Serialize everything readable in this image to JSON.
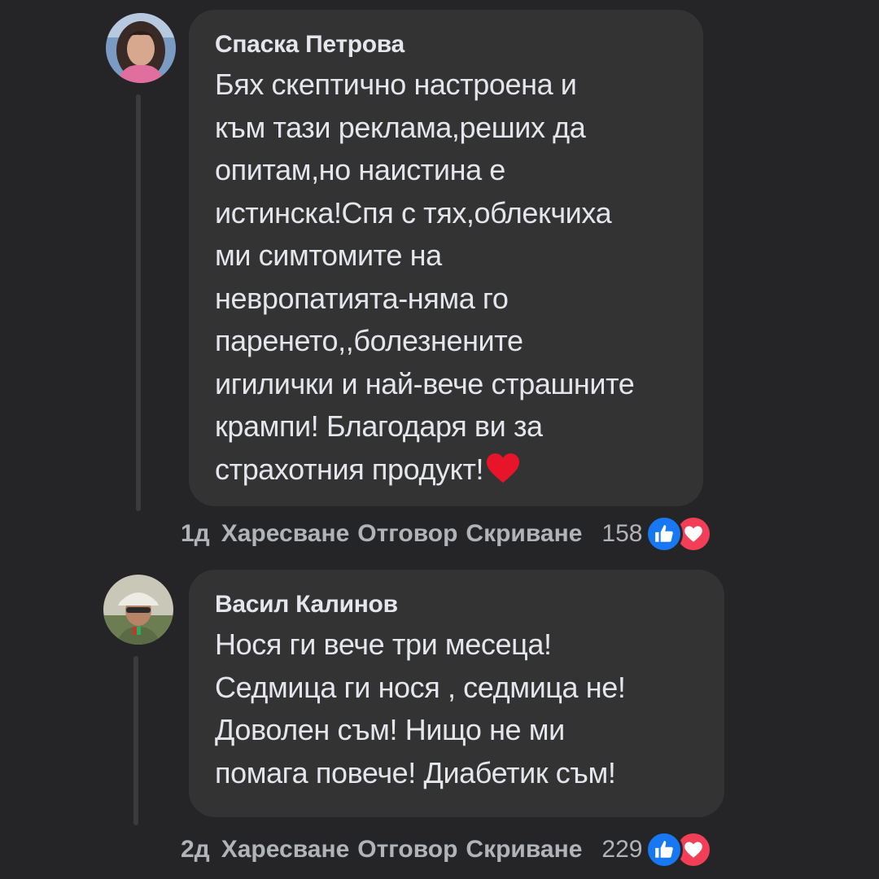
{
  "comments": [
    {
      "author": "Спаска Петрова",
      "text": "Бях скептично настроена и\nкъм тази реклама,реших да\nопитам,но наистина е\nистинска!Спя с тях,облекчиха\nми симтомите на\nневропатията-няма го\nпаренето,,болезнените\nигилички и най-вече страшните\nкрампи! Благодаря ви за\nстрахотния продукт!",
      "trailing_emoji": "red-heart",
      "time": "1д",
      "like_label": "Харесване",
      "reply_label": "Отговор",
      "hide_label": "Скриване",
      "reaction_count": "158",
      "reactions": [
        "like",
        "love"
      ]
    },
    {
      "author": "Васил Калинов",
      "text": "Нося ги вече три месеца!\nСедмица ги нося , седмица не!\nДоволен съм! Нищо не ми\nпомага повече! Диабетик съм!",
      "time": "2д",
      "like_label": "Харесване",
      "reply_label": "Отговор",
      "hide_label": "Скриване",
      "reaction_count": "229",
      "reactions": [
        "like",
        "love"
      ]
    }
  ],
  "colors": {
    "background": "#252527",
    "bubble": "#333334",
    "text": "#e4e6eb",
    "meta": "#b0b3b8",
    "like": "#1877f2",
    "love": "#f33e58"
  }
}
